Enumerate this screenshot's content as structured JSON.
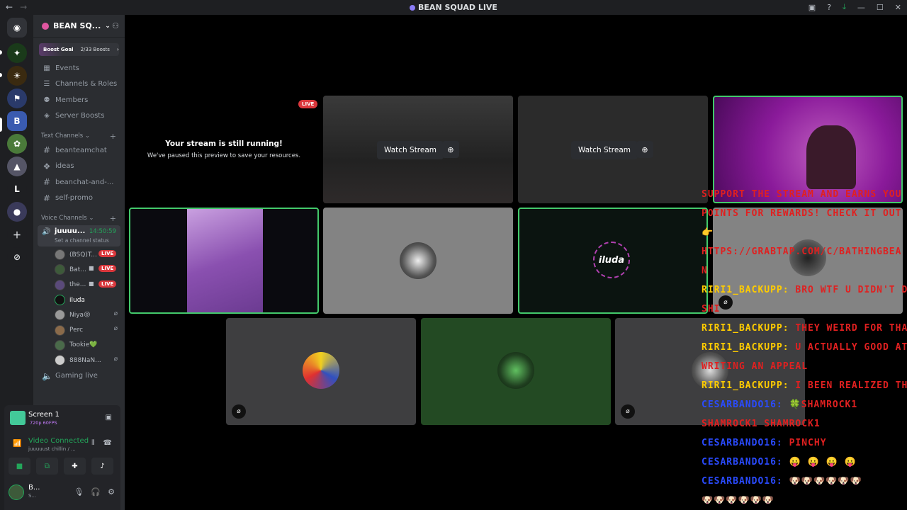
{
  "titlebar": {
    "title": "BEAN SQUAD LIVE"
  },
  "server": {
    "name": "BEAN SQ...",
    "boost_label": "Boost Goal",
    "boost_count": "2/33 Boosts"
  },
  "menu": [
    "Events",
    "Channels & Roles",
    "Members",
    "Server Boosts"
  ],
  "text_category": "Text Channels",
  "text_channels": [
    "beanteamchat",
    "ideas",
    "beanchat-and-...",
    "self-promo"
  ],
  "voice_category": "Voice Channels",
  "active_voice": {
    "name": "juuuu...",
    "time": "14:50:59",
    "status": "Set a channel status"
  },
  "voice_users": [
    {
      "name": "(BSQ)T...",
      "live": "LIVE"
    },
    {
      "name": "Bat...",
      "live": "LIVE"
    },
    {
      "name": "the...",
      "live": "LIVE"
    },
    {
      "name": "iluda"
    },
    {
      "name": "Niya😝"
    },
    {
      "name": "Perc"
    },
    {
      "name": "Tookie💚"
    },
    {
      "name": "888NaN..."
    }
  ],
  "gaming_channel": "Gaming live",
  "panel": {
    "screen_title": "Screen 1",
    "screen_sub": "720p 60FPS",
    "video_connected": "Video Connected",
    "video_sub": "juuuuust chillin / ...",
    "user_name": "B...",
    "user_status": "S..."
  },
  "stream": {
    "still_running": "Your stream is still running!",
    "paused": "We've paused this preview to save your resources.",
    "live": "LIVE",
    "watch_label": "Watch Stream",
    "iluda_logo": "iluda"
  },
  "overlay": [
    {
      "parts": [
        {
          "c": "red",
          "t": "SUPPORT THE STREAM AND EARNS YOU"
        }
      ]
    },
    {
      "parts": [
        {
          "c": "red",
          "t": "POINTS FOR REWARDS! CHECK IT OUT"
        }
      ]
    },
    {
      "parts": [
        {
          "c": "yel",
          "t": "👉"
        }
      ]
    },
    {
      "parts": [
        {
          "c": "red",
          "t": "HTTPS://GRABTAP.COM/C/BATHINGBEA"
        }
      ]
    },
    {
      "parts": [
        {
          "c": "red",
          "t": "N"
        }
      ]
    },
    {
      "parts": [
        {
          "c": "yel",
          "t": "RIRI1_BACKUPP: "
        },
        {
          "c": "red",
          "t": "BRO WTF U DIDN'T DO"
        }
      ]
    },
    {
      "parts": [
        {
          "c": "red",
          "t": "SHI"
        }
      ]
    },
    {
      "parts": [
        {
          "c": "yel",
          "t": "RIRI1_BACKUPP: "
        },
        {
          "c": "red",
          "t": "THEY WEIRD FOR THAT"
        }
      ]
    },
    {
      "parts": [
        {
          "c": "yel",
          "t": "RIRI1_BACKUPP: "
        },
        {
          "c": "red",
          "t": "U ACTUALLY GOOD AT"
        }
      ]
    },
    {
      "parts": [
        {
          "c": "red",
          "t": "WRITING AN APPEAL"
        }
      ]
    },
    {
      "parts": [
        {
          "c": "yel",
          "t": "RIRI1_BACKUPP: "
        },
        {
          "c": "red",
          "t": "I BEEN REALIZED THAT"
        }
      ]
    },
    {
      "parts": [
        {
          "c": "blu",
          "t": "CESARBANDO16: "
        },
        {
          "c": "red",
          "t": "🍀SHAMROCK1"
        }
      ]
    },
    {
      "parts": [
        {
          "c": "red",
          "t": "SHAMROCK1 SHAMROCK1"
        }
      ]
    },
    {
      "parts": [
        {
          "c": "blu",
          "t": "CESARBANDO16: "
        },
        {
          "c": "red",
          "t": "PINCHY"
        }
      ]
    },
    {
      "parts": [
        {
          "c": "blu",
          "t": "CESARBANDO16: "
        },
        {
          "c": "yel",
          "t": "😛 😛 😛 😛"
        }
      ]
    },
    {
      "parts": [
        {
          "c": "blu",
          "t": "CESARBANDO16: "
        },
        {
          "c": "yel",
          "t": "🐶🐶🐶🐶🐶🐶"
        }
      ]
    },
    {
      "parts": [
        {
          "c": "yel",
          "t": "🐶🐶🐶🐶🐶🐶"
        }
      ]
    }
  ]
}
